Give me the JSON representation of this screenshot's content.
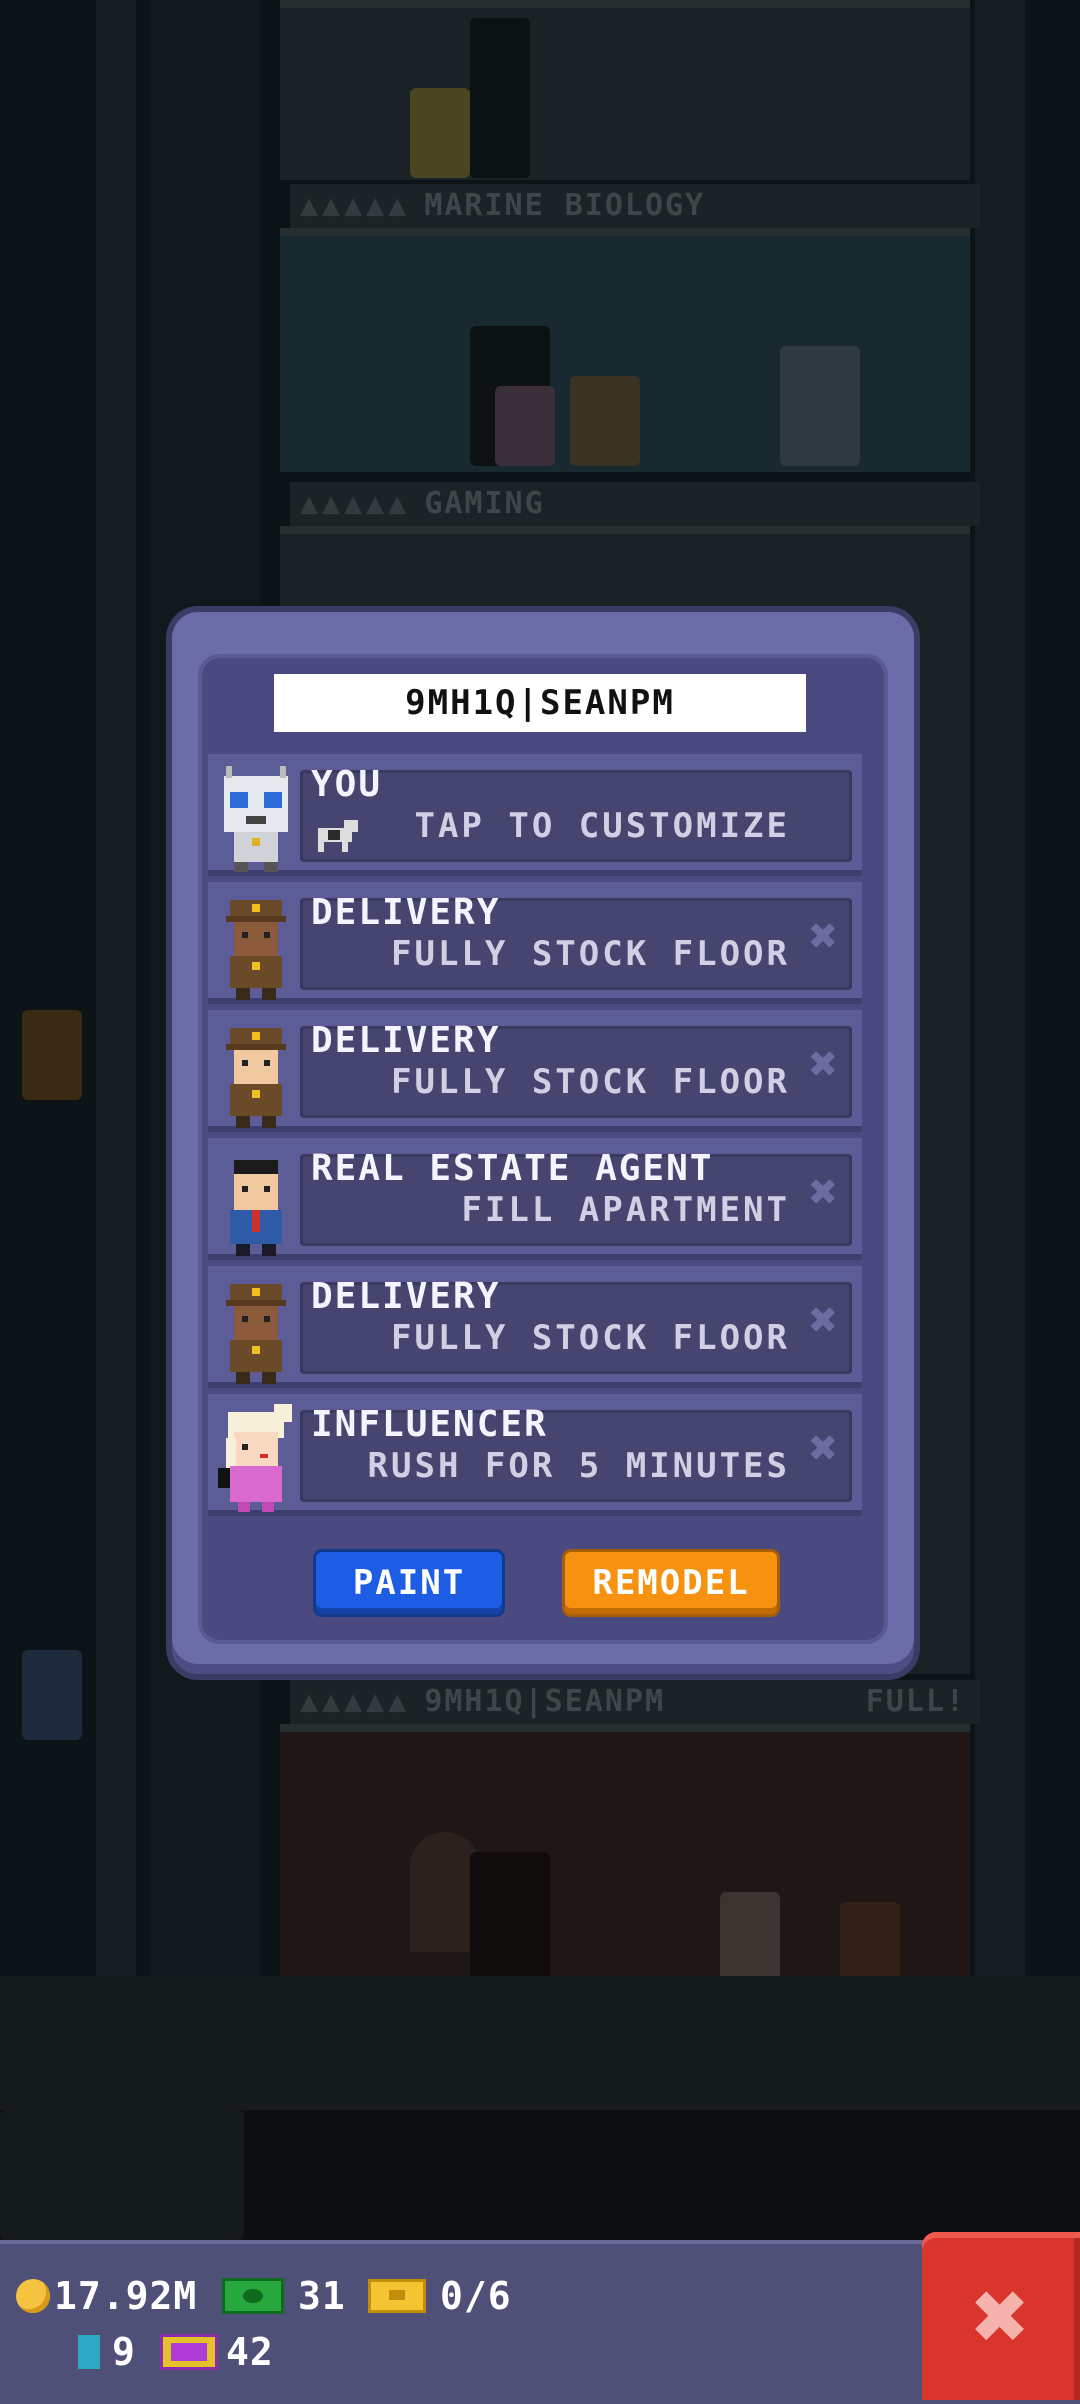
{
  "background": {
    "floors": [
      {
        "name": "MARINE BIOLOGY",
        "status": ""
      },
      {
        "name": "GAMING",
        "status": ""
      },
      {
        "name": "9MH1Q|SEANPM",
        "status": "FULL!"
      }
    ]
  },
  "dialog": {
    "name": "9MH1Q|SEANPM",
    "rows": [
      {
        "title": "YOU",
        "subtitle": "TAP TO CUSTOMIZE",
        "avatar": "robot-avatar",
        "removable": false
      },
      {
        "title": "DELIVERY",
        "subtitle": "FULLY STOCK FLOOR",
        "avatar": "delivery-avatar",
        "removable": true
      },
      {
        "title": "DELIVERY",
        "subtitle": "FULLY STOCK FLOOR",
        "avatar": "delivery-avatar",
        "removable": true
      },
      {
        "title": "REAL ESTATE AGENT",
        "subtitle": "FILL APARTMENT",
        "avatar": "real-estate-agent-avatar",
        "removable": true
      },
      {
        "title": "DELIVERY",
        "subtitle": "FULLY STOCK FLOOR",
        "avatar": "delivery-avatar",
        "removable": true
      },
      {
        "title": "INFLUENCER",
        "subtitle": "RUSH FOR 5 MINUTES",
        "avatar": "influencer-avatar",
        "removable": true
      }
    ],
    "remove_glyph": "✖",
    "paint_label": "PAINT",
    "remodel_label": "REMODEL"
  },
  "hud": {
    "coins": "17.92M",
    "bux": "31",
    "tickets": "0/6",
    "bitizens": "9",
    "vip": "42",
    "close_glyph": "✖"
  },
  "colors": {
    "dialog": "#6c6ca8",
    "paint": "#1d5de6",
    "remodel": "#f6920f",
    "close": "#d9352c"
  }
}
